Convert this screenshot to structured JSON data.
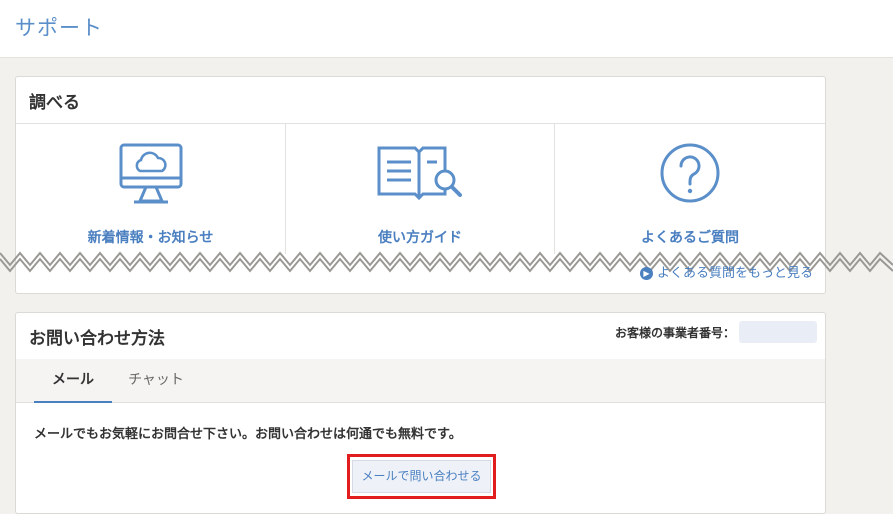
{
  "header": {
    "title": "サポート"
  },
  "search_panel": {
    "title": "調べる",
    "cards": [
      {
        "label": "新着情報・お知らせ",
        "icon": "cloud-monitor-icon"
      },
      {
        "label": "使い方ガイド",
        "icon": "book-search-icon"
      },
      {
        "label": "よくあるご質問",
        "icon": "question-circle-icon"
      }
    ],
    "faq_link": "よくある質問をもっと見る"
  },
  "contact_panel": {
    "title": "お問い合わせ方法",
    "business_number_label": "お客様の事業者番号：",
    "tabs": [
      {
        "label": "メール"
      },
      {
        "label": "チャット"
      }
    ],
    "active_tab": "メール",
    "info_text": "メールでもお気軽にお問合せ下さい。お問い合わせは何通でも無料です。",
    "mail_button": "メールで問い合わせる"
  },
  "colors": {
    "accent": "#4a7fc0",
    "highlight": "#e21d1d",
    "background": "#f2f1ee"
  }
}
